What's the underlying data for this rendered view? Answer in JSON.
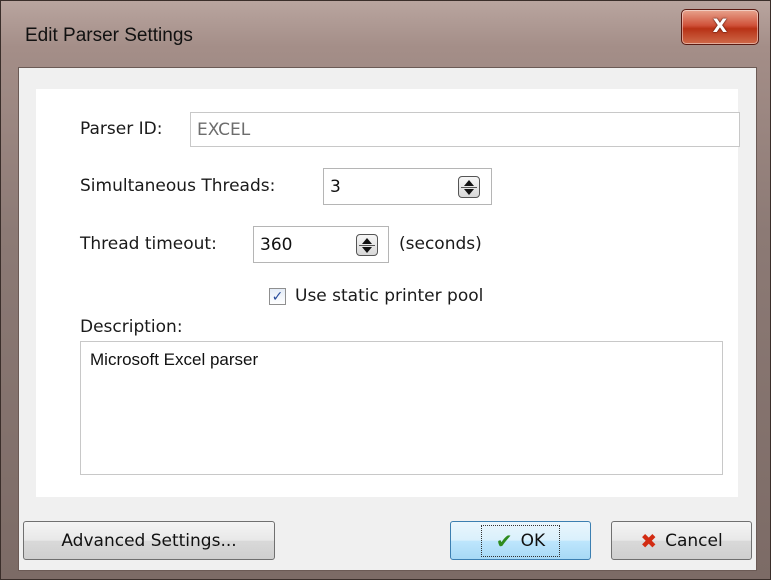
{
  "window": {
    "title": "Edit Parser Settings",
    "close_symbol": "X"
  },
  "form": {
    "parser_id": {
      "label": "Parser ID:",
      "value": "EXCEL"
    },
    "threads": {
      "label": "Simultaneous Threads:",
      "value": "3"
    },
    "timeout": {
      "label": "Thread timeout:",
      "value": "360",
      "unit": "(seconds)"
    },
    "static_pool": {
      "label": "Use static printer pool",
      "checked": true
    },
    "description": {
      "label": "Description:",
      "value": "Microsoft Excel parser"
    }
  },
  "buttons": {
    "advanced": "Advanced Settings...",
    "ok": "OK",
    "cancel": "Cancel"
  },
  "icons": {
    "ok": "checkmark-icon",
    "cancel": "red-x-icon"
  },
  "colors": {
    "ok_check": "#2e8b1e",
    "cancel_x": "#d22b12",
    "close_button": "#c8432a"
  }
}
